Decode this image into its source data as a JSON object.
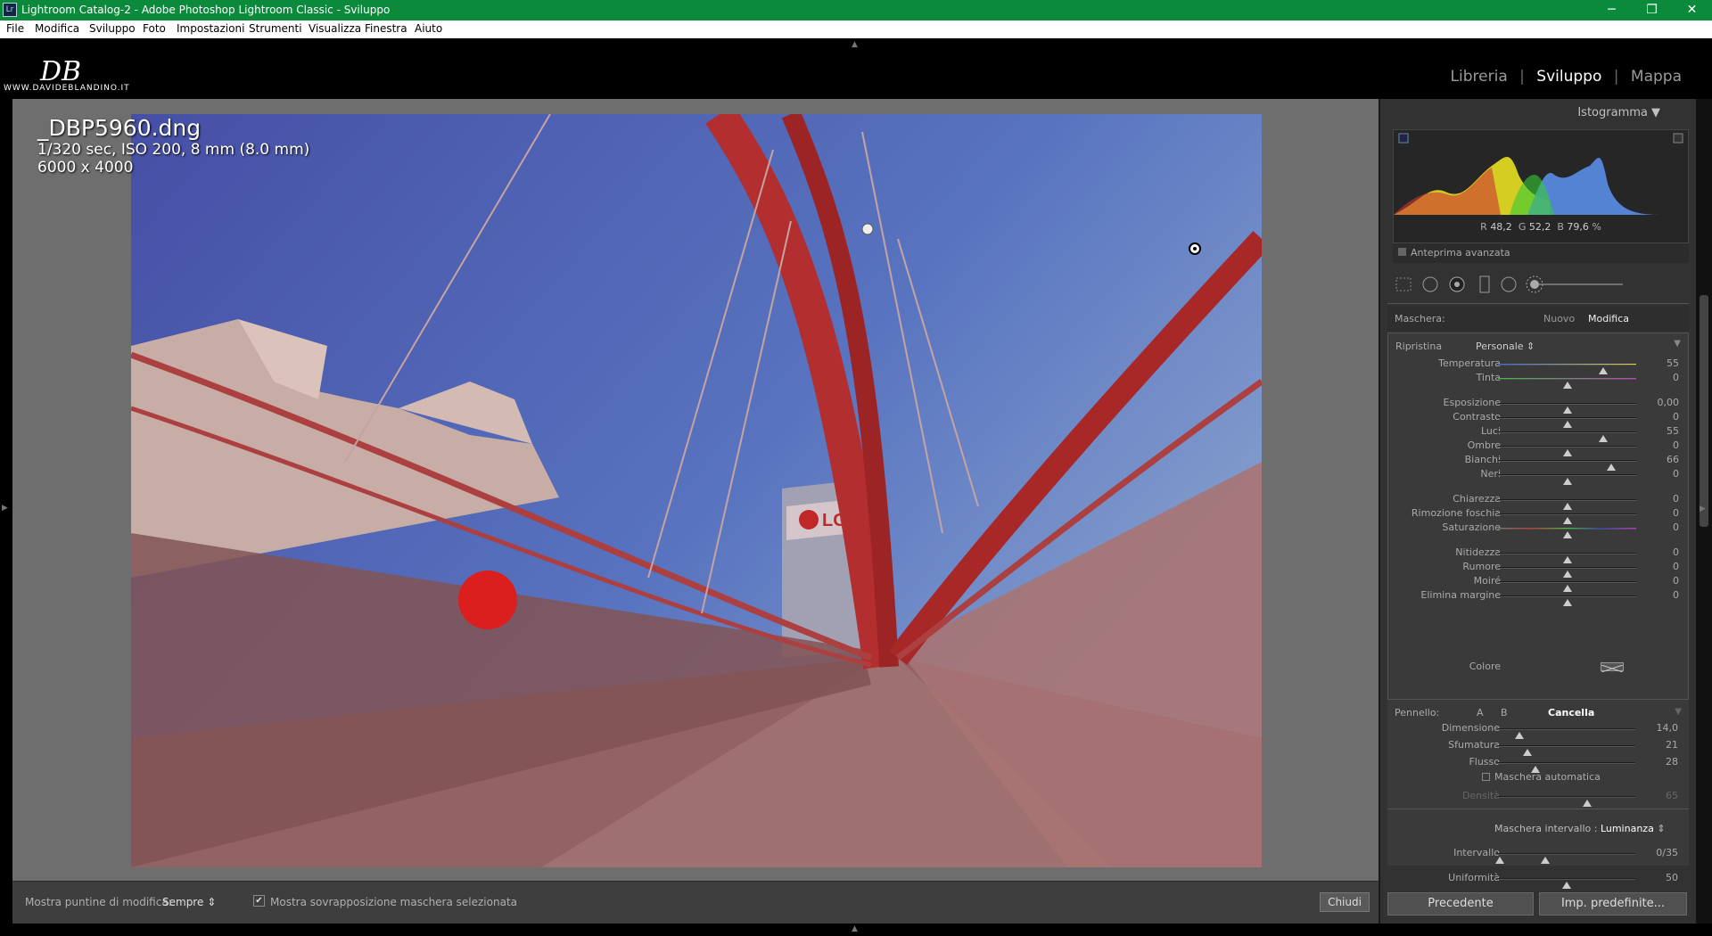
{
  "window": {
    "title": "Lightroom Catalog-2 - Adobe Photoshop Lightroom Classic - Sviluppo",
    "app_icon": "Lr",
    "controls": [
      "minimize-icon",
      "restore-icon",
      "close-icon"
    ]
  },
  "menu": [
    "File",
    "Modifica",
    "Sviluppo",
    "Foto",
    "Impostazioni",
    "Strumenti",
    "Visualizza",
    "Finestra",
    "Aiuto"
  ],
  "identity": {
    "signature": "DB",
    "url": "WWW.DAVIDEBLANDINO.IT"
  },
  "modules": {
    "items": [
      "Libreria",
      "Sviluppo",
      "Mappa"
    ],
    "separator": "|",
    "active": "Sviluppo"
  },
  "image_info": {
    "filename": "_DBP5960.dng",
    "exposure": "1/320 sec, ISO 200, 8 mm (8.0 mm)",
    "dimensions": "6000 x 4000"
  },
  "photo": {
    "signage_text": "LG"
  },
  "toolbar": {
    "show_pins_label": "Mostra puntine di modifica:",
    "show_pins_value": "Sempre",
    "overlay_checked": "✔",
    "overlay_label": "Mostra sovrapposizione maschera selezionata",
    "close_button": "Chiudi"
  },
  "right_panel": {
    "histogram_title": "Istogramma",
    "rgb": {
      "r_label": "R",
      "r": "48,2",
      "g_label": "G",
      "g": "52,2",
      "b_label": "B",
      "b": "79,6",
      "unit": "%"
    },
    "preview_label": "Anteprima avanzata",
    "mask": {
      "label": "Maschera:",
      "new": "Nuovo",
      "edit": "Modifica"
    },
    "preset": {
      "reset": "Ripristina",
      "value": "Personale"
    },
    "adjustments": [
      {
        "label": "Temperatura",
        "value": "55",
        "pos": 0.76
      },
      {
        "label": "Tinta",
        "value": "0",
        "pos": 0.5
      },
      {
        "label": "Esposizione",
        "value": "0,00",
        "pos": 0.5
      },
      {
        "label": "Contrasto",
        "value": "0",
        "pos": 0.5
      },
      {
        "label": "Luci",
        "value": "55",
        "pos": 0.76
      },
      {
        "label": "Ombre",
        "value": "0",
        "pos": 0.5
      },
      {
        "label": "Bianchi",
        "value": "66",
        "pos": 0.82
      },
      {
        "label": "Neri",
        "value": "0",
        "pos": 0.5
      },
      {
        "label": "Chiarezza",
        "value": "0",
        "pos": 0.5
      },
      {
        "label": "Rimozione foschia",
        "value": "0",
        "pos": 0.5
      },
      {
        "label": "Saturazione",
        "value": "0",
        "pos": 0.5
      },
      {
        "label": "Nitidezza",
        "value": "0",
        "pos": 0.5
      },
      {
        "label": "Rumore",
        "value": "0",
        "pos": 0.5
      },
      {
        "label": "Moiré",
        "value": "0",
        "pos": 0.5
      },
      {
        "label": "Elimina margine",
        "value": "0",
        "pos": 0.5
      }
    ],
    "color_label": "Colore",
    "brush": {
      "label": "Pennello:",
      "a": "A",
      "b": "B",
      "erase": "Cancella",
      "size_label": "Dimensione",
      "size": "14,0",
      "size_pos": 0.16,
      "feather_label": "Sfumatura",
      "feather": "21",
      "feather_pos": 0.22,
      "flow_label": "Flusso",
      "flow": "28",
      "flow_pos": 0.28,
      "automask_label": "Maschera automatica",
      "density_label": "Densità",
      "density": "65",
      "density_pos": 0.65
    },
    "range_mask": {
      "label": "Maschera intervallo :",
      "value": "Luminanza",
      "range_label": "Intervallo",
      "range": "0/35",
      "smooth_label": "Uniformità",
      "smooth": "50"
    },
    "buttons": {
      "previous": "Precedente",
      "defaults": "Imp. predefinite..."
    }
  }
}
